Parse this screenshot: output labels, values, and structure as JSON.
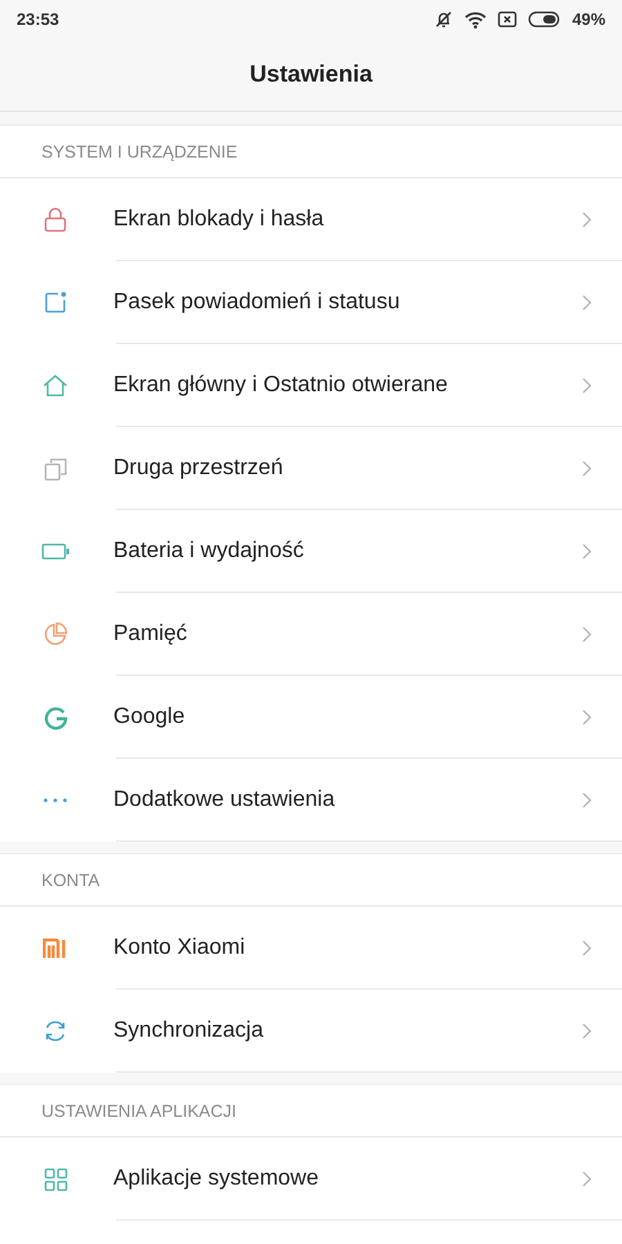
{
  "status_bar": {
    "time": "23:53",
    "battery": "49%"
  },
  "title": "Ustawienia",
  "sections": [
    {
      "header": "SYSTEM I URZĄDZENIE",
      "items": [
        {
          "label": "Ekran blokady i hasła",
          "kind": "lock",
          "color": "#e0737b"
        },
        {
          "label": "Pasek powiadomień i statusu",
          "kind": "notification",
          "color": "#4a9fd8"
        },
        {
          "label": "Ekran główny i Ostatnio otwierane",
          "kind": "home",
          "color": "#4fb8a5"
        },
        {
          "label": "Druga przestrzeń",
          "kind": "copy",
          "color": "#b5b5b5"
        },
        {
          "label": "Bateria i wydajność",
          "kind": "battery",
          "color": "#4fb8a5"
        },
        {
          "label": "Pamięć",
          "kind": "pie",
          "color": "#f0a070"
        },
        {
          "label": "Google",
          "kind": "g",
          "color": "#3fb39a"
        },
        {
          "label": "Dodatkowe ustawienia",
          "kind": "dots",
          "color": "#4a9fd8"
        }
      ]
    },
    {
      "header": "KONTA",
      "items": [
        {
          "label": "Konto Xiaomi",
          "kind": "mi",
          "color": "#f7893a"
        },
        {
          "label": "Synchronizacja",
          "kind": "sync",
          "color": "#3a9fd0"
        }
      ]
    },
    {
      "header": "USTAWIENIA APLIKACJI",
      "items": [
        {
          "label": "Aplikacje systemowe",
          "kind": "grid",
          "color": "#4fb8a5"
        }
      ]
    }
  ]
}
